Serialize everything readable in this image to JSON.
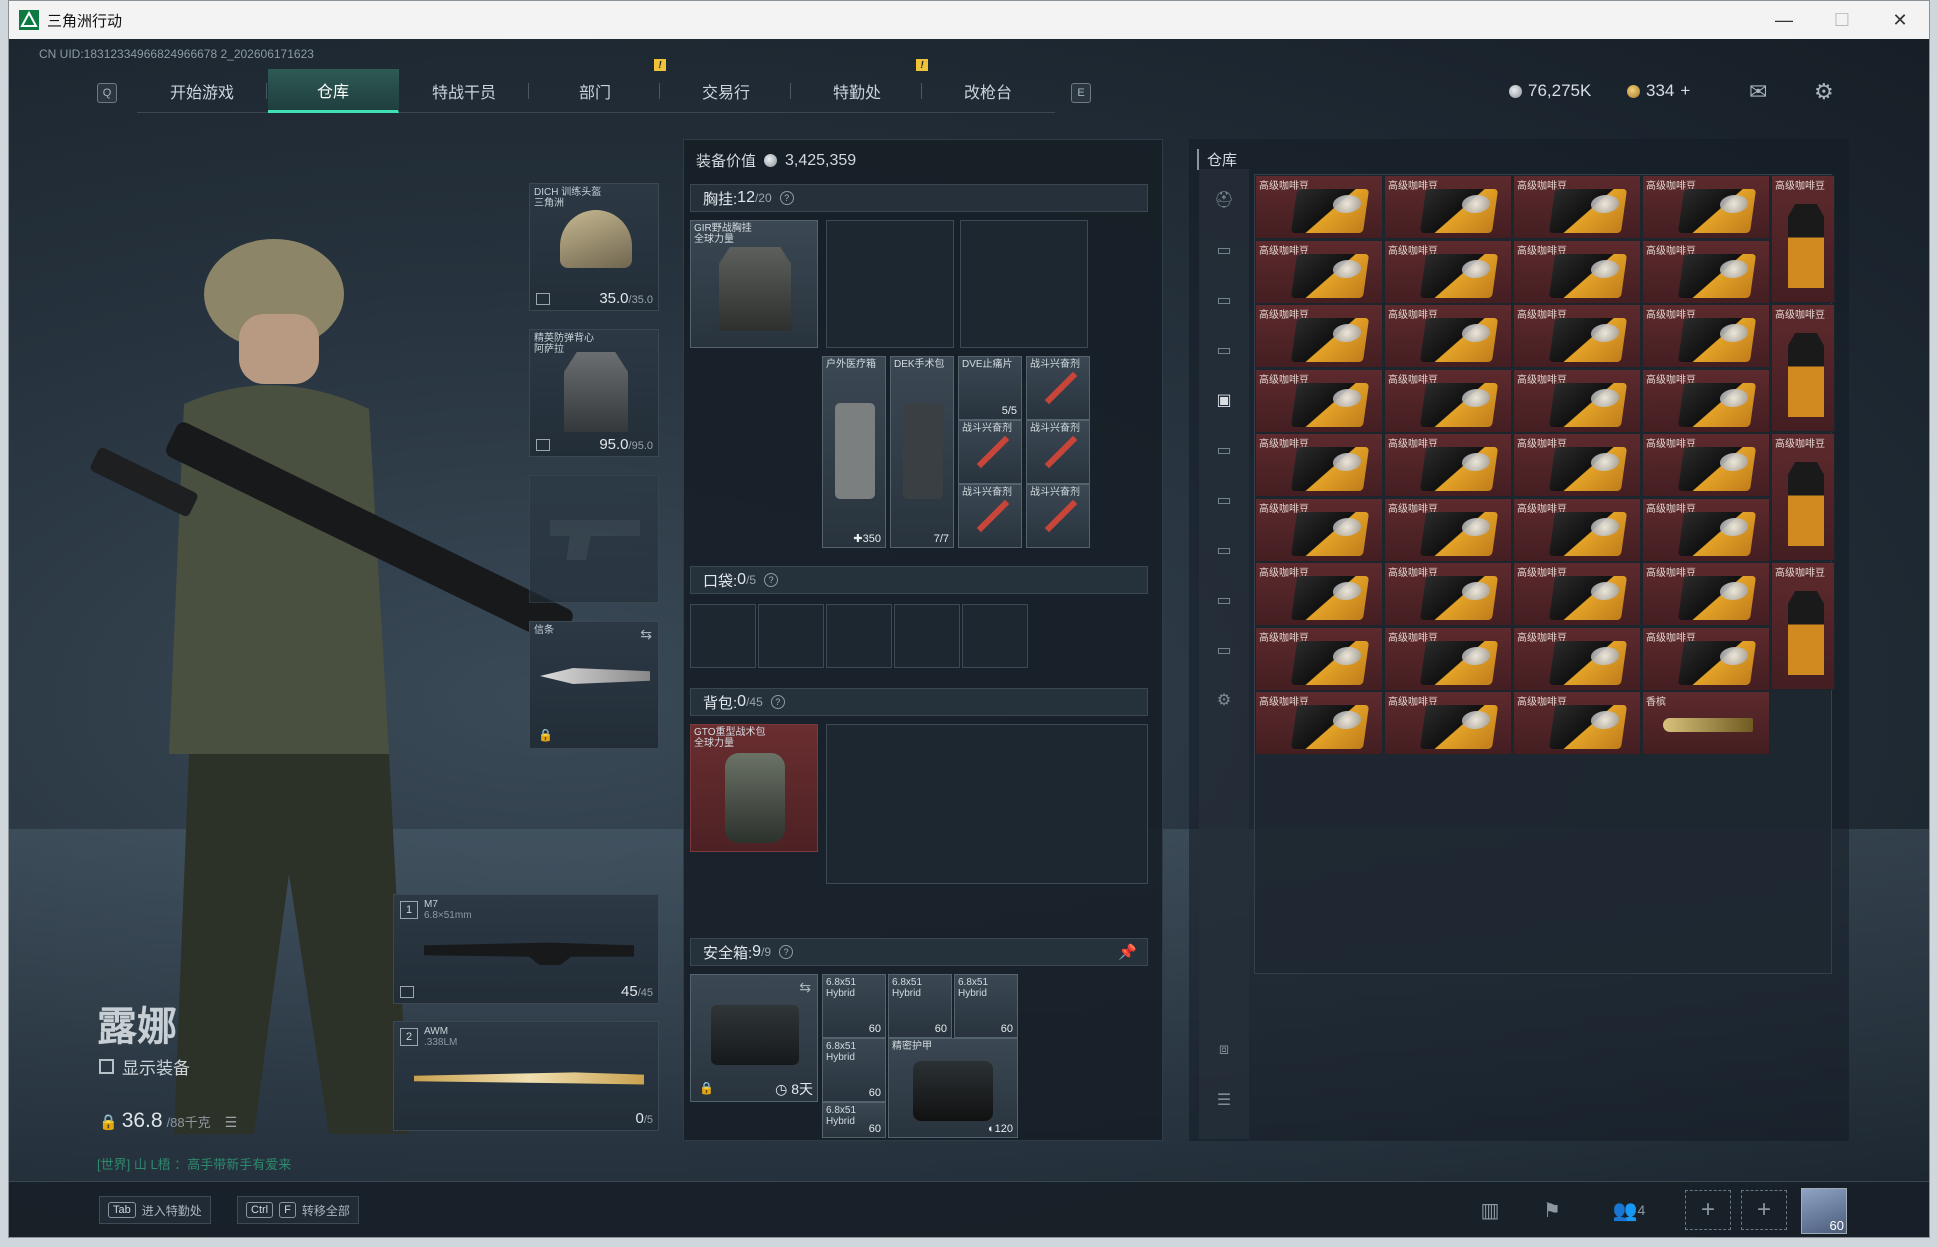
{
  "window": {
    "title": "三角洲行动",
    "minimize": "—",
    "maximize": "☐",
    "close": "✕"
  },
  "uid": "CN UID:18312334966824966678 2_202606171623",
  "nav": {
    "left_key": "Q",
    "right_key": "E",
    "tabs": [
      {
        "label": "开始游戏"
      },
      {
        "label": "仓库",
        "active": true
      },
      {
        "label": "特战干员"
      },
      {
        "label": "部门",
        "warn": true
      },
      {
        "label": "交易行"
      },
      {
        "label": "特勤处",
        "warn": true
      },
      {
        "label": "改枪台"
      }
    ]
  },
  "currency": {
    "silver": "76,275K",
    "gold": "334",
    "plus": "+"
  },
  "character": {
    "name": "露娜",
    "show_gear": "显示装备",
    "weight": "36.8",
    "weight_max": "/88千克",
    "chat": "[世界] 山 L梧 ：高手带新手有爱来"
  },
  "gear": {
    "helmet": {
      "label": "DICH 训练头盔\n三角洲",
      "value": "35.0",
      "max": "/35.0"
    },
    "armor": {
      "label": "精英防弹背心\n阿萨拉",
      "value": "95.0",
      "max": "/95.0"
    },
    "melee": {
      "label": "信条"
    },
    "weapon1": {
      "num": "1",
      "name": "M7",
      "ammo": "6.8×51mm",
      "count": "45",
      "max": "/45"
    },
    "weapon2": {
      "num": "2",
      "name": "AWM",
      "ammo": ".338LM",
      "count": "0",
      "max": "/5"
    }
  },
  "equip_value": {
    "label": "装备价值",
    "value": "3,425,359"
  },
  "chest": {
    "label": "胸挂: ",
    "count": "12",
    "cap": "/20",
    "rig_name": "GIR野战胸挂\n全球力量",
    "items": [
      {
        "name": "户外医疗箱",
        "count": "✚350"
      },
      {
        "name": "DEK手术包",
        "count": "7/7"
      },
      {
        "name": "DVE止痛片",
        "count": "5/5"
      },
      {
        "name": "战斗兴奋剂"
      },
      {
        "name": "战斗兴奋剂"
      },
      {
        "name": "战斗兴奋剂"
      },
      {
        "name": "战斗兴奋剂"
      },
      {
        "name": "战斗兴奋剂"
      }
    ]
  },
  "pocket": {
    "label": "口袋: ",
    "count": "0",
    "cap": "/5"
  },
  "backpack": {
    "label": "背包: ",
    "count": "0",
    "cap": "/45",
    "bag_name": "GTO重型战术包\n全球力量"
  },
  "safebox": {
    "label": "安全箱: ",
    "count": "9",
    "cap": "/9",
    "timer": "8天",
    "items": [
      {
        "name": "6.8x51\nHybrid",
        "count": "60"
      },
      {
        "name": "6.8x51\nHybrid",
        "count": "60"
      },
      {
        "name": "6.8x51\nHybrid",
        "count": "60"
      },
      {
        "name": "6.8x51\nHybrid",
        "count": "60"
      },
      {
        "name": "6.8x51\nHybrid",
        "count": "60"
      }
    ],
    "armor_item": {
      "name": "精密护甲",
      "count": "120"
    }
  },
  "warehouse": {
    "title": "仓库",
    "item_label": "高级咖啡豆",
    "special_item": "香槟"
  },
  "bottom": {
    "tab_key": "Tab",
    "tab_label": "进入特勤处",
    "ctrl_key": "Ctrl",
    "f_key": "F",
    "transfer_label": "转移全部",
    "squad_count": "4",
    "level": "60"
  }
}
